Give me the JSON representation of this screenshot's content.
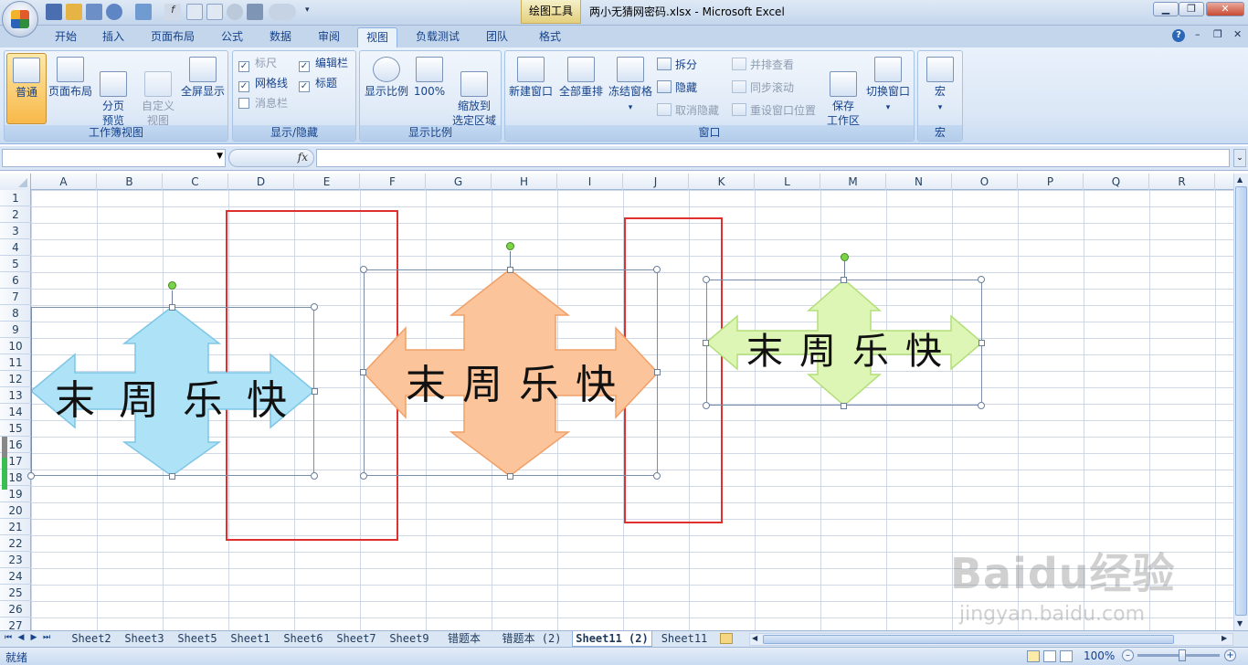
{
  "titlebar": {
    "contextual_tab": "绘图工具",
    "title": "两小无猜网密码.xlsx - Microsoft Excel"
  },
  "tabs": [
    "开始",
    "插入",
    "页面布局",
    "公式",
    "数据",
    "审阅",
    "视图",
    "负载测试",
    "团队",
    "格式"
  ],
  "active_tab": "视图",
  "ribbon": {
    "workbook_views": {
      "label": "工作簿视图",
      "normal": "普通",
      "page_layout": "页面布局",
      "page_break": "分页\n预览",
      "custom": "自定义\n视图",
      "fullscreen": "全屏显示"
    },
    "show_hide": {
      "label": "显示/隐藏",
      "ruler": "标尺",
      "gridlines": "网格线",
      "message_bar": "消息栏",
      "formula_bar": "编辑栏",
      "headings": "标题"
    },
    "zoom": {
      "label": "显示比例",
      "zoom": "显示比例",
      "hundred": "100%",
      "to_selection": "缩放到\n选定区域"
    },
    "window": {
      "label": "窗口",
      "new_window": "新建窗口",
      "arrange_all": "全部重排",
      "freeze": "冻结窗格",
      "split": "拆分",
      "hide": "隐藏",
      "unhide": "取消隐藏",
      "side_by_side": "并排查看",
      "sync_scroll": "同步滚动",
      "reset_pos": "重设窗口位置",
      "save_ws": "保存\n工作区",
      "switch": "切换窗口"
    },
    "macros": {
      "label": "宏",
      "macros": "宏"
    }
  },
  "formula_bar": {
    "name_box": "",
    "fx": "fx",
    "content": ""
  },
  "columns": [
    "A",
    "B",
    "C",
    "D",
    "E",
    "F",
    "G",
    "H",
    "I",
    "J",
    "K",
    "L",
    "M",
    "N",
    "O",
    "P",
    "Q",
    "R"
  ],
  "rows": [
    "1",
    "2",
    "3",
    "4",
    "5",
    "6",
    "7",
    "8",
    "9",
    "10",
    "11",
    "12",
    "13",
    "14",
    "15",
    "16",
    "17",
    "18",
    "19",
    "20",
    "21",
    "22",
    "23",
    "24",
    "25",
    "26",
    "27"
  ],
  "shapes": [
    {
      "text": [
        "末",
        "周",
        "乐",
        "快"
      ],
      "fill": "#aee3f7",
      "stroke": "#7fc6e6"
    },
    {
      "text": [
        "末",
        "周",
        "乐",
        "快"
      ],
      "fill": "#fbc49a",
      "stroke": "#f0a068"
    },
    {
      "text": [
        "末",
        "周",
        "乐",
        "快"
      ],
      "fill": "#ddf5b5",
      "stroke": "#b3df7a"
    }
  ],
  "sheet_tabs": [
    "Sheet2",
    "Sheet3",
    "Sheet5",
    "Sheet1",
    "Sheet6",
    "Sheet7",
    "Sheet9",
    "错题本",
    "错题本 (2)",
    "Sheet11 (2)",
    "Sheet11"
  ],
  "active_sheet": "Sheet11 (2)",
  "status": {
    "ready": "就绪",
    "zoom": "100%"
  },
  "watermark": {
    "brand": "Baidu经验",
    "url": "jingyan.baidu.com"
  },
  "colors": {
    "accent": "#15428b",
    "highlight_box": "#e02f2f"
  }
}
